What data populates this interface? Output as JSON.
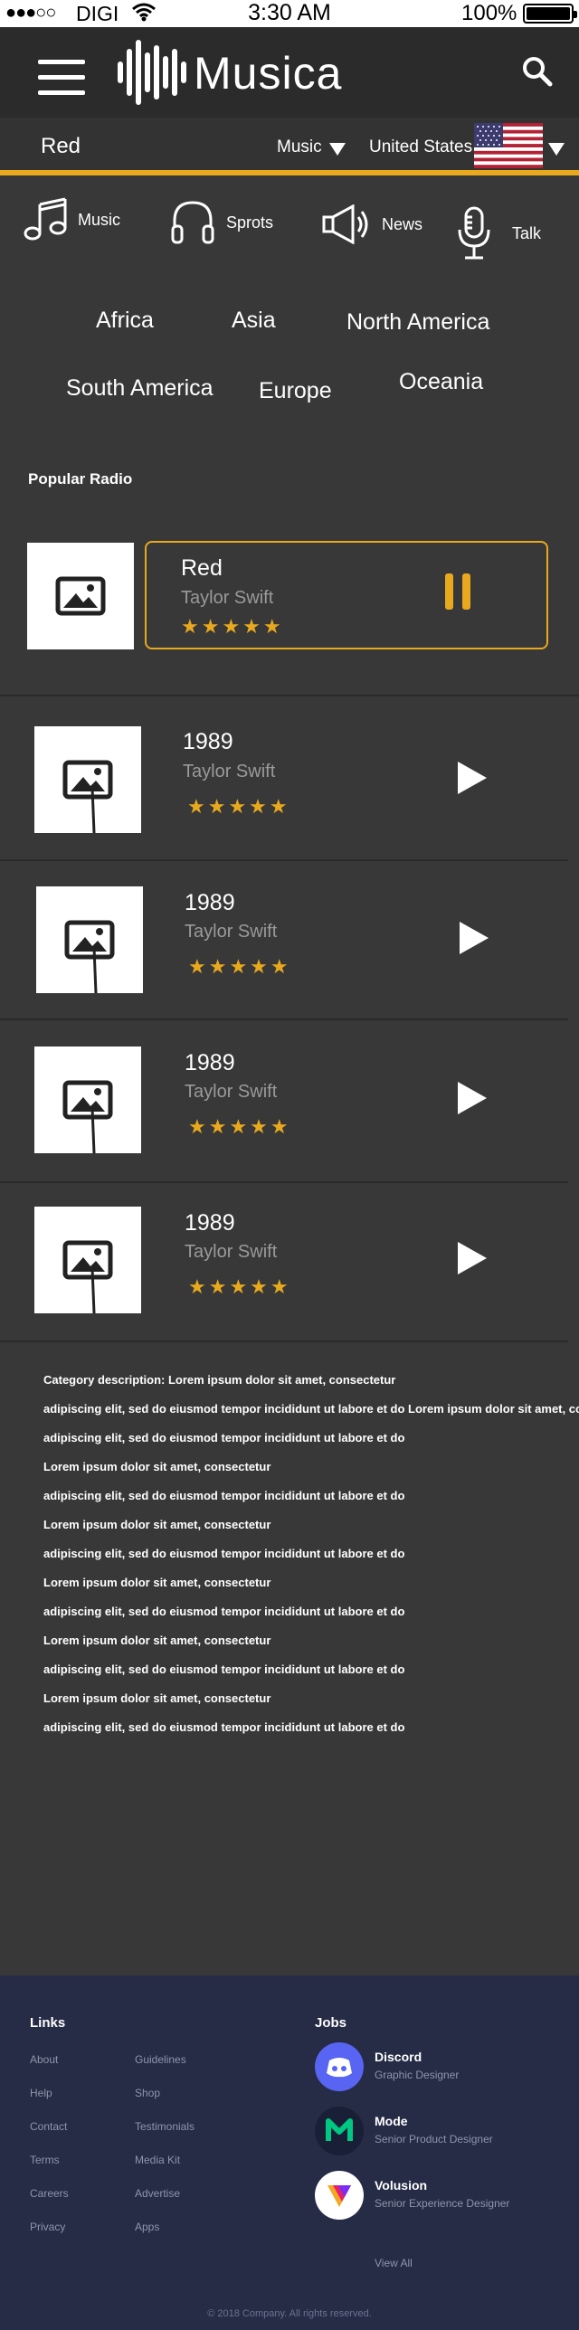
{
  "status_bar": {
    "carrier": "DIGI",
    "time": "3:30 AM",
    "battery": "100%",
    "signal_dots": "●●●○○"
  },
  "header": {
    "brand": "Musica",
    "menu_icon": "hamburger-menu-icon",
    "search_icon": "search-icon"
  },
  "filter_bar": {
    "title": "Red",
    "genre": "Music",
    "country": "United States"
  },
  "categories": [
    {
      "label": "Music",
      "icon": "music-note-icon"
    },
    {
      "label": "Sprots",
      "icon": "headphones-icon"
    },
    {
      "label": "News",
      "icon": "megaphone-icon"
    },
    {
      "label": "Talk",
      "icon": "microphone-icon"
    }
  ],
  "regions": [
    "Africa",
    "Asia",
    "North America",
    "South America",
    "Europe",
    "Oceania"
  ],
  "popular": {
    "title": "Popular Radio",
    "now_playing": {
      "title": "Red",
      "artist": "Taylor Swift",
      "stars": "★★★★★",
      "rating": 5
    },
    "tracks": [
      {
        "title": "1989",
        "artist": "Taylor Swift",
        "stars": "★★★★★",
        "rating": 5
      },
      {
        "title": "1989",
        "artist": "Taylor Swift",
        "stars": "★★★★★",
        "rating": 5
      },
      {
        "title": "1989",
        "artist": "Taylor Swift",
        "stars": "★★★★★",
        "rating": 5
      },
      {
        "title": "1989",
        "artist": "Taylor Swift",
        "stars": "★★★★★",
        "rating": 5
      }
    ]
  },
  "description": [
    "Category description: Lorem ipsum dolor sit amet, consectetur",
    "adipiscing elit, sed do eiusmod tempor incididunt ut labore et do Lorem ipsum dolor sit amet, consectetur",
    "adipiscing elit, sed do eiusmod tempor incididunt ut labore et do",
    "Lorem ipsum dolor sit amet, consectetur",
    "adipiscing elit, sed do eiusmod tempor incididunt ut labore et do",
    "Lorem ipsum dolor sit amet, consectetur",
    "adipiscing elit, sed do eiusmod tempor incididunt ut labore et do",
    "Lorem ipsum dolor sit amet, consectetur",
    "adipiscing elit, sed do eiusmod tempor incididunt ut labore et do",
    "Lorem ipsum dolor sit amet, consectetur",
    "adipiscing elit, sed do eiusmod tempor incididunt ut labore et do",
    "Lorem ipsum dolor sit amet, consectetur",
    "adipiscing elit, sed do eiusmod tempor incididunt ut labore et do"
  ],
  "footer": {
    "links_title": "Links",
    "links_col1": [
      "About",
      "Help",
      "Contact",
      "Terms",
      "Careers",
      "Privacy"
    ],
    "links_col2": [
      "Guidelines",
      "Shop",
      "Testimonials",
      "Media Kit",
      "Advertise",
      "Apps"
    ],
    "jobs_title": "Jobs",
    "jobs": [
      {
        "company": "Discord",
        "role": "Graphic Designer",
        "icon": "discord-logo-icon"
      },
      {
        "company": "Mode",
        "role": "Senior Product Designer",
        "icon": "mode-logo-icon"
      },
      {
        "company": "Volusion",
        "role": "Senior Experience Designer",
        "icon": "volusion-logo-icon"
      }
    ],
    "view_all": "View All",
    "copyright": "© 2018 Company. All rights reserved."
  },
  "colors": {
    "accent": "#e8a91e",
    "footer_bg": "#262b46",
    "page_bg": "#383838",
    "header_bg": "#2b2b2b"
  }
}
